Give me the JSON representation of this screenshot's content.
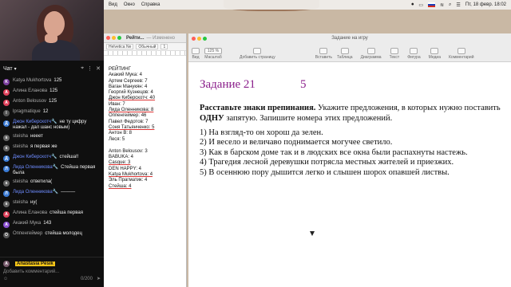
{
  "stream": {
    "chat_title": "Чат",
    "header_icons": [
      "pin-icon",
      "more-icon",
      "close-icon"
    ],
    "messages": [
      {
        "author": "Katya Mukhortova",
        "text": "125",
        "color": "#7b3fa0",
        "initial": "K"
      },
      {
        "author": "Алина Еланова",
        "text": "125",
        "color": "#e0405a",
        "initial": "А"
      },
      {
        "author": "Anton Belousov",
        "text": "125",
        "color": "#e0405a",
        "initial": "A"
      },
      {
        "author": "lpragmatique",
        "text": "12",
        "color": "#555",
        "initial": "l"
      },
      {
        "author": "Джон Киберскотч🔧",
        "text": "не ту цифру нажал - дал шанс новым)",
        "color": "#3a7bd5",
        "initial": "Д",
        "mod": true
      },
      {
        "author": "steisha",
        "text": "нееет",
        "color": "#666",
        "initial": "s"
      },
      {
        "author": "steisha",
        "text": "я первая же",
        "color": "#666",
        "initial": "s"
      },
      {
        "author": "Джон Киберскотч🔧",
        "text": "стейша!!",
        "color": "#3a7bd5",
        "initial": "Д",
        "mod": true
      },
      {
        "author": "Лида Оленникова🔧",
        "text": "Стейша первая была",
        "color": "#3a7bd5",
        "initial": "Л",
        "mod": true
      },
      {
        "author": "steisha",
        "text": "ответила(",
        "color": "#666",
        "initial": "s"
      },
      {
        "author": "Лида Оленникова🔧",
        "text": "———",
        "color": "#3a7bd5",
        "initial": "Л",
        "mod": true
      },
      {
        "author": "steisha",
        "text": "ну(",
        "color": "#666",
        "initial": "s"
      },
      {
        "author": "Алина Еланова",
        "text": "стейша первая",
        "color": "#e0405a",
        "initial": "А"
      },
      {
        "author": "Акакий Мука",
        "text": "143",
        "color": "#8a4fd0",
        "initial": "А"
      },
      {
        "author": "Оппенгеймер",
        "text": "стейша молодец",
        "color": "#555",
        "initial": "О"
      }
    ],
    "footer": {
      "user": "Anastasia Pesik",
      "placeholder": "Добавить комментарий...",
      "counter": "0/200"
    }
  },
  "menubar": {
    "items": [
      "Вид",
      "Окно",
      "Справка"
    ],
    "datetime": "Пт, 18 февр.  18:02"
  },
  "notes": {
    "title": "Рейти...",
    "subtitle": "— Изменено",
    "font": "Helvetica Ne",
    "style": "Обычный",
    "size": "1",
    "heading": "РЕЙТИНГ",
    "list1": [
      "Акакий Мука: 4",
      "Артем Сергеев: 7",
      "Ваган Манукян: 4",
      "Георгий Кузнецов: 4",
      "Джон Киберскотч: 40",
      "Иван: 7",
      "Лида Оленникова: 8",
      "Оппенгеймер: 46",
      "Павел Федотов: 7",
      "Соня Татьянченко: 5",
      "Антон В: 8",
      "Леся: 5"
    ],
    "list2": [
      "Anton Belousov: 3",
      "BABUKA: 4",
      "Casque: 3",
      "DEN HAPPY: 4",
      "Katya Mukhortova: 4",
      "Эль Прагматик: 4",
      "Стейша: 4"
    ]
  },
  "pages": {
    "window_title": "Задание на игру",
    "toolbar": [
      {
        "label": "Вид",
        "cls": "view"
      },
      {
        "label": "Масштаб",
        "cls": "zoom"
      },
      {
        "label": "Добавить страницу",
        "cls": "add"
      },
      {
        "label": "Вставить",
        "cls": "ins"
      },
      {
        "label": "Таблица"
      },
      {
        "label": "Диаграмма"
      },
      {
        "label": "Текст"
      },
      {
        "label": "Фигура"
      },
      {
        "label": "Медиа"
      },
      {
        "label": "Комментарий"
      }
    ],
    "zoom": "125 %",
    "task_label": "Задание 21",
    "task_points": "5",
    "instruction_bold": "Расставьте знаки препинания.",
    "instruction_rest_1": " Укажите предложения, в которых нужно поставить ",
    "instruction_emph": "ОДНУ",
    "instruction_rest_2": " запятую. Запишите номера этих предложений.",
    "sentences": [
      "1) На взгляд-то он хорош да зелен.",
      "2) И весело и величаво поднимается могучее светило.",
      "3) Как в барском доме так и в людских все окна были распахнуты настежь.",
      "4) Трагедия лесной деревушки потрясла местных жителей и приезжих.",
      "5) В осеннюю пору дышится легко и слышен шорох опавшей листвы."
    ]
  }
}
